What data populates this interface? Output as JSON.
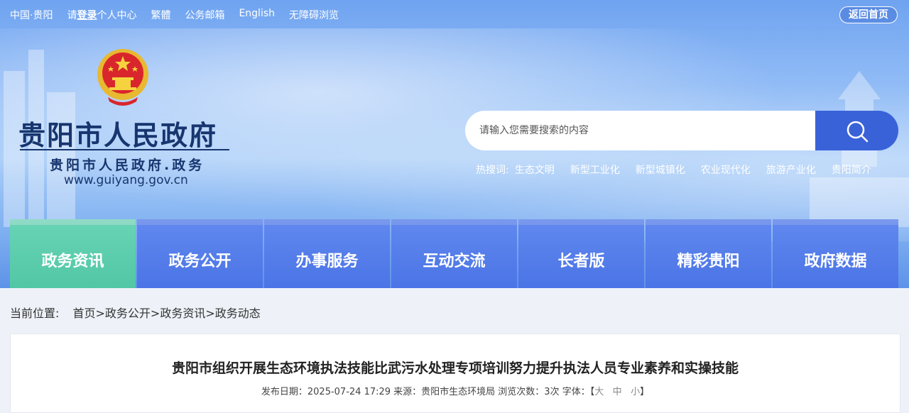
{
  "topbar": {
    "links": [
      "中国·贵阳",
      "请",
      "登录",
      "个人中心",
      "繁體",
      "公务邮箱",
      "English",
      "无障碍浏览"
    ],
    "home_button": "返回首页"
  },
  "header": {
    "title": "贵阳市人民政府",
    "subtitle": "贵阳市人民政府.政务",
    "url": "www.guiyang.gov.cn"
  },
  "search": {
    "placeholder": "请输入您需要搜索的内容",
    "hot_label": "热搜词:",
    "hot_keywords": [
      "生态文明",
      "新型工业化",
      "新型城镇化",
      "农业现代化",
      "旅游产业化",
      "贵阳简介"
    ]
  },
  "nav": {
    "items": [
      "政务资讯",
      "政务公开",
      "办事服务",
      "互动交流",
      "长者版",
      "精彩贵阳",
      "政府数据"
    ],
    "active_index": 0
  },
  "breadcrumb": {
    "label": "当前位置:",
    "path": "首页>政务公开>政务资讯>政务动态"
  },
  "article": {
    "title": "贵阳市组织开展生态环境执法技能比武污水处理专项培训努力提升执法人员专业素养和实操技能",
    "meta": "发布日期：2025-07-24 17:29 来源：贵阳市生态环境局 浏览次数：3次 字体：【",
    "font_sizes": [
      "大",
      "中",
      "小"
    ],
    "meta_end": "】"
  },
  "colors": {
    "nav_blue": "#4b74e6",
    "nav_active": "#52c7a5",
    "title_navy": "#17356e"
  }
}
